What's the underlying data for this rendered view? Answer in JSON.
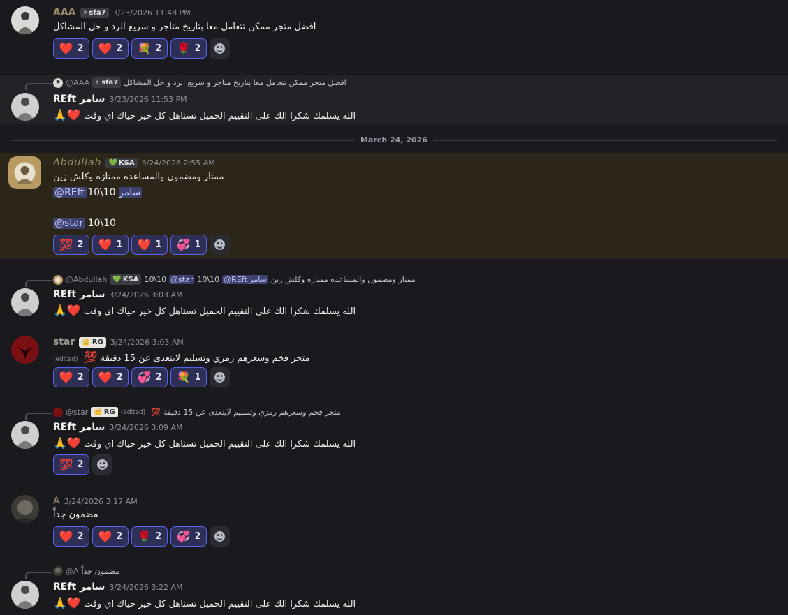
{
  "colors": {
    "background": "#1a1a1e",
    "reaction_border": "#5865f2",
    "reaction_bg": "#2d2f57",
    "mention_bg": "#3c4270",
    "gold_name": "#a08c6a"
  },
  "date_divider": "March 24, 2026",
  "messages": [
    {
      "user": "AAA",
      "tag": "sfa7",
      "tag_icon": "lightning-icon",
      "time": "3/23/2026 11:48 PM",
      "text": "افضل متجر ممكن تتعامل معا بتاريخ متاجر و سريع الرد و حل المشاكل",
      "reactions": [
        {
          "emoji": "❤️",
          "count": "2"
        },
        {
          "emoji": "❤️",
          "count": "2"
        },
        {
          "emoji": "💐",
          "count": "2"
        },
        {
          "emoji": "🌹",
          "count": "2"
        }
      ]
    },
    {
      "reply_user": "@AAA",
      "reply_tag": "sfa7",
      "reply_text": "افضل متجر ممكن تتعامل معا بتاريخ متاجر و سريع الرد و حل المشاكل",
      "user": "REft سامر",
      "time": "3/23/2026 11:53 PM",
      "text": "الله يسلمك شكرا الك على التقييم الجميل تستاهل كل خير حياك اي وقت",
      "emojis": "🙏❤️"
    },
    {
      "user": "Abdullah",
      "tag": "KSA",
      "tag_icon": "green-heart-icon",
      "time": "3/24/2026 2:55 AM",
      "text": "ممتاز ومضمون والمساعده ممتازه وكلش زين",
      "line2_mention": "@REft سامر",
      "line2_text": "10\\10",
      "line3_mention": "@star",
      "line3_text": "10\\10",
      "reactions": [
        {
          "emoji": "💯",
          "count": "2"
        },
        {
          "emoji": "❤️",
          "count": "1"
        },
        {
          "emoji": "❤️",
          "count": "1"
        },
        {
          "emoji": "💞",
          "count": "1"
        }
      ]
    },
    {
      "reply_user": "@Abdullah",
      "reply_tag": "KSA",
      "reply_text_a": "10\\10",
      "reply_mention_a": "@star",
      "reply_text_b": "10\\10",
      "reply_mention_b": "@REft سامر",
      "reply_text_c": "ممتاز ومضمون والمساعده ممتازه وكلش زين",
      "user": "REft سامر",
      "time": "3/24/2026 3:03 AM",
      "text": "الله يسلمك شكرا الك على التقييم الجميل تستاهل كل خير حياك اي وقت",
      "emojis": "🙏❤️"
    },
    {
      "user": "star",
      "tag": "RG",
      "tag_icon": "crown-icon",
      "time": "3/24/2026 3:03 AM",
      "edited": "(edited)",
      "text": "متجر فخم وسعرهم رمزي وتسليم لايتعدى عن 15 دقيقة",
      "emojis": "💯",
      "reactions": [
        {
          "emoji": "❤️",
          "count": "2"
        },
        {
          "emoji": "❤️",
          "count": "2"
        },
        {
          "emoji": "💞",
          "count": "2"
        },
        {
          "emoji": "💐",
          "count": "1"
        }
      ]
    },
    {
      "reply_user": "@star",
      "reply_tag": "RG",
      "reply_edited": "(edited)",
      "reply_text": "متجر فخم وسعرهم رمزي وتسليم لايتعدى عن 15 دقيقة",
      "reply_emoji": "💯",
      "user": "REft سامر",
      "time": "3/24/2026 3:09 AM",
      "text": "الله يسلمك شكرا الك على التقييم الجميل تستاهل كل خير حياك اي وقت",
      "emojis": "🙏❤️",
      "reactions": [
        {
          "emoji": "💯",
          "count": "2"
        }
      ]
    },
    {
      "user": "A",
      "time": "3/24/2026 3:17 AM",
      "text": "مضمون جداً",
      "reactions": [
        {
          "emoji": "❤️",
          "count": "2"
        },
        {
          "emoji": "❤️",
          "count": "2"
        },
        {
          "emoji": "🌹",
          "count": "2"
        },
        {
          "emoji": "💞",
          "count": "2"
        }
      ]
    },
    {
      "reply_user": "@A",
      "reply_text": "مضمون جداً",
      "user": "REft سامر",
      "time": "3/24/2026 3:22 AM",
      "text": "الله يسلمك شكرا الك على التقييم الجميل تستاهل كل خير حياك اي وقت",
      "emojis": "🙏❤️"
    }
  ]
}
